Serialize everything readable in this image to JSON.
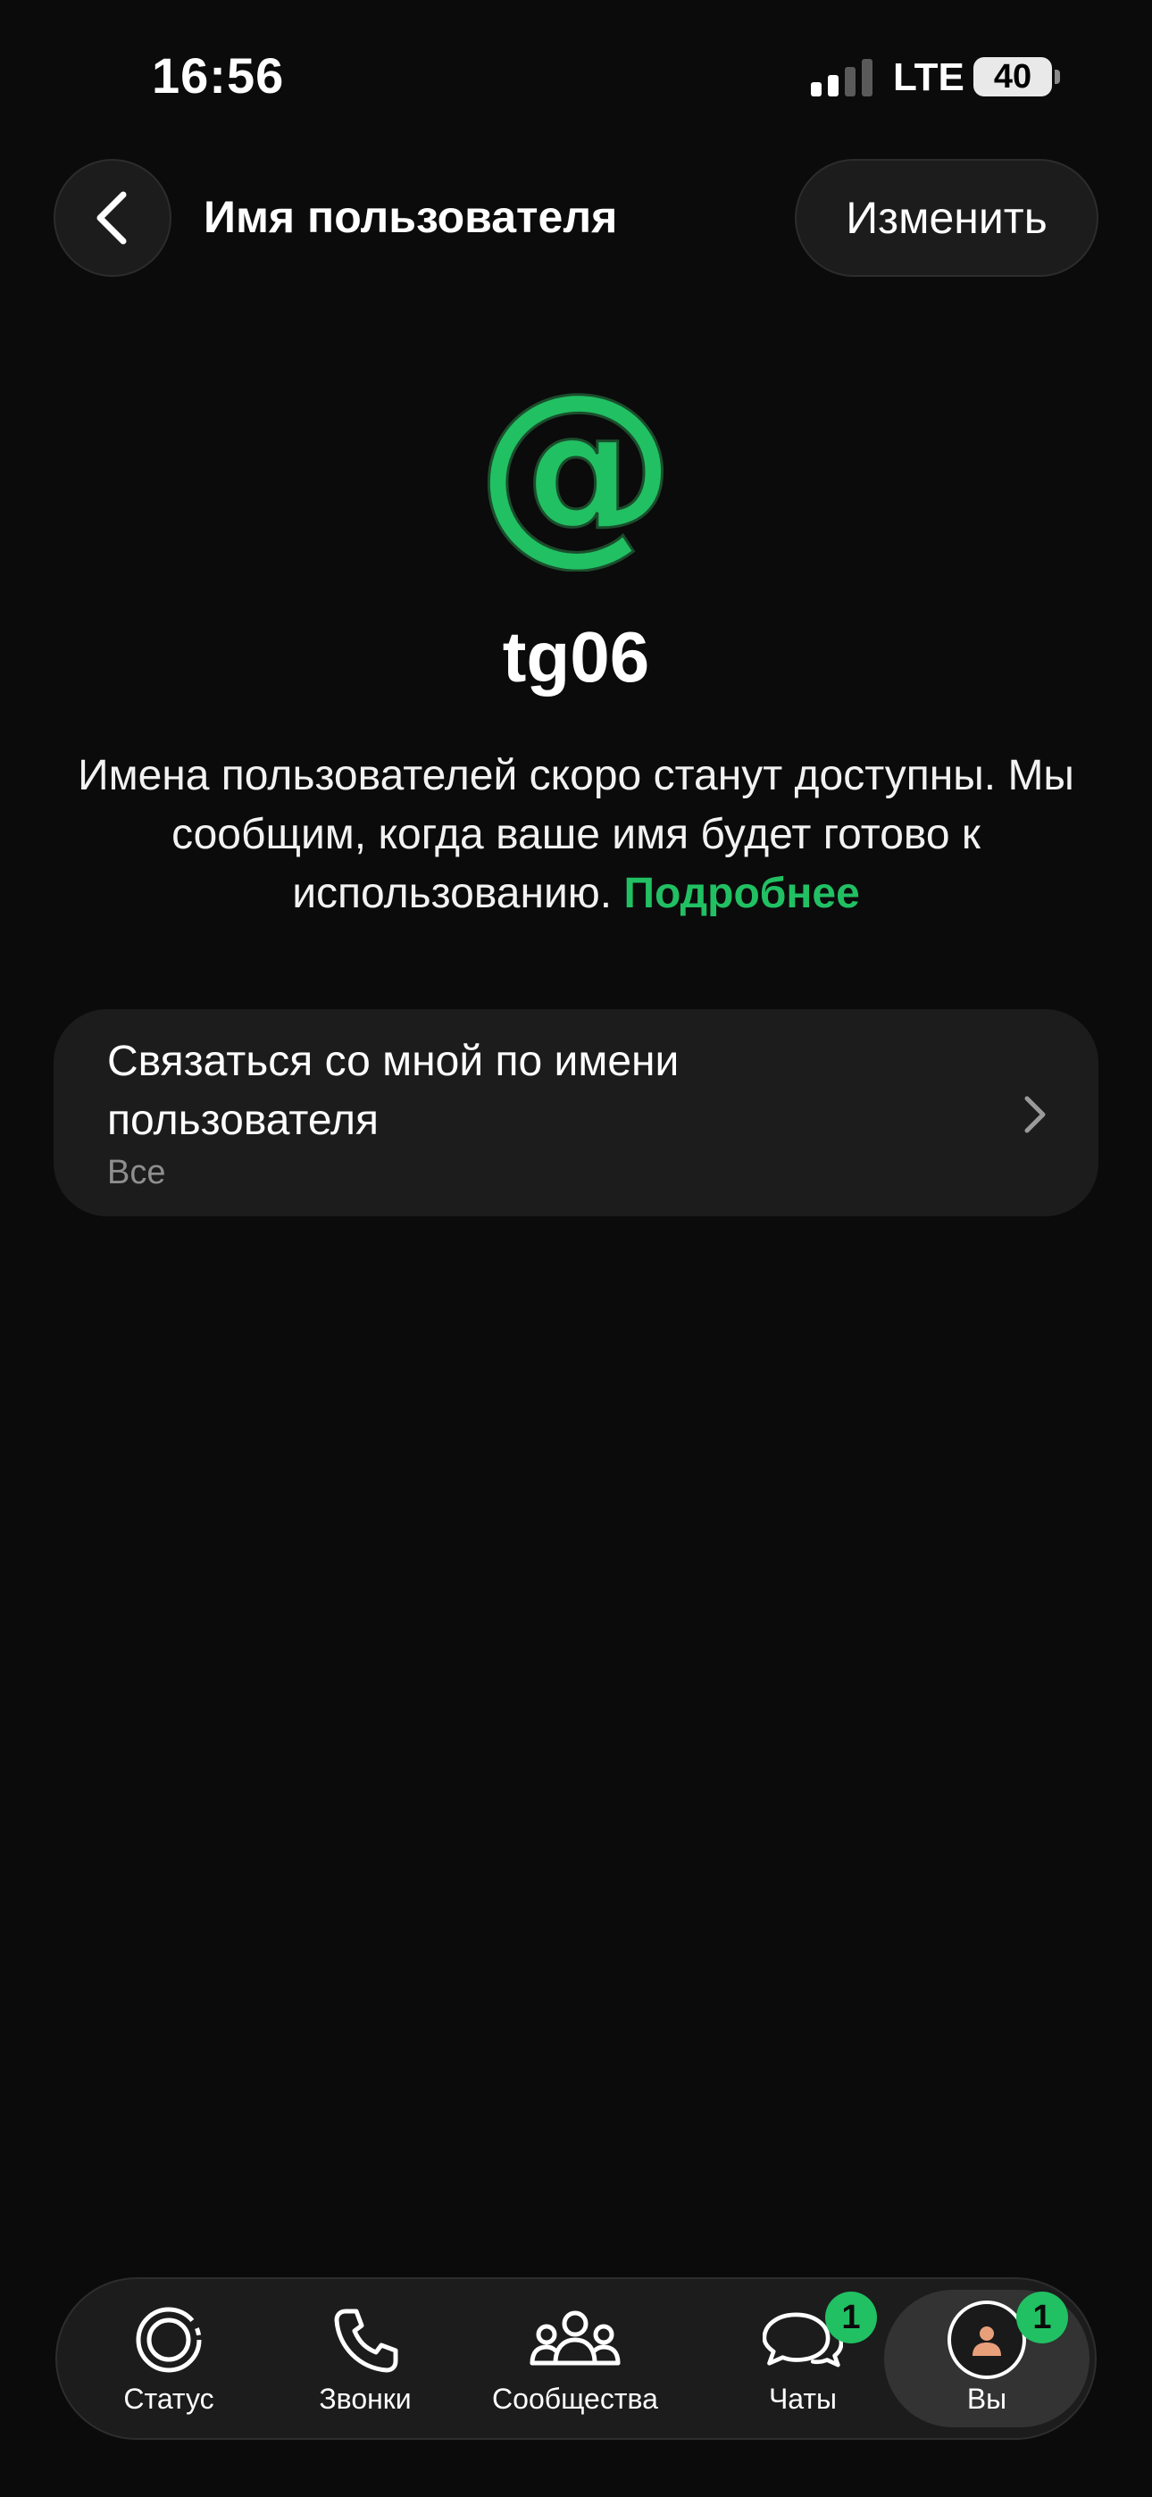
{
  "status_bar": {
    "time": "16:56",
    "network": "LTE",
    "battery": "40"
  },
  "header": {
    "title": "Имя пользователя",
    "edit_label": "Изменить"
  },
  "profile": {
    "username": "tg06",
    "description": "Имена пользователей скоро станут доступны. Мы сообщим, когда ваше имя будет готово к использованию.",
    "more_link": "Подробнее"
  },
  "setting": {
    "title": "Связаться со мной по имени пользователя",
    "value": "Все"
  },
  "tabs": [
    {
      "label": "Статус",
      "icon": "status-icon"
    },
    {
      "label": "Звонки",
      "icon": "phone-icon"
    },
    {
      "label": "Сообщества",
      "icon": "communities-icon"
    },
    {
      "label": "Чаты",
      "icon": "chats-icon",
      "badge": "1"
    },
    {
      "label": "Вы",
      "icon": "avatar-icon",
      "badge": "1",
      "active": true
    }
  ],
  "colors": {
    "accent": "#21c063",
    "background": "#0b0b0b",
    "surface": "#1c1c1c"
  }
}
